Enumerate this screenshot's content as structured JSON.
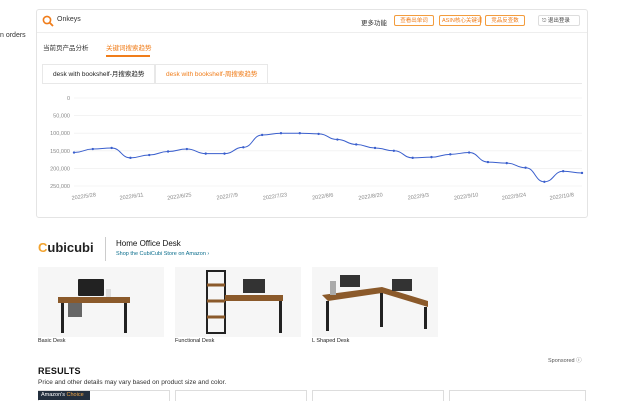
{
  "page": {
    "left_cut_text": "n orders"
  },
  "toolbar": {
    "brand": "Onkeys",
    "more_label": "更多功能",
    "buttons": [
      "查看出单词",
      "ASIN核心关键词",
      "竞品反查数",
      "竞品报告"
    ],
    "logout": "退出登录"
  },
  "main_tabs": [
    {
      "label": "当前页产品分析",
      "active": false
    },
    {
      "label": "关键词搜索趋势",
      "active": true
    }
  ],
  "keyword_tabs": [
    {
      "label": "desk with bookshelf-月搜索趋势",
      "active": false
    },
    {
      "label": "desk with bookshelf-周搜索趋势",
      "active": true
    }
  ],
  "chart_data": {
    "type": "line",
    "y_ticks": [
      "0",
      "50,000",
      "100,000",
      "150,000",
      "200,000",
      "250,000"
    ],
    "x_ticks": [
      "2022/5/28",
      "2022/6/11",
      "2022/6/25",
      "2022/7/9",
      "2022/7/23",
      "2022/8/6",
      "2022/8/20",
      "2022/9/3",
      "2022/9/10",
      "2022/9/24",
      "2022/10/8"
    ],
    "ylim": [
      0,
      250000
    ],
    "y_inverted": true,
    "grid": true,
    "series_color": "#3a5fcd",
    "values": [
      155000,
      145000,
      142000,
      170000,
      162000,
      152000,
      145000,
      158000,
      158000,
      140000,
      105000,
      100000,
      100000,
      102000,
      118000,
      132000,
      142000,
      150000,
      170000,
      168000,
      160000,
      155000,
      182000,
      185000,
      198000,
      238000,
      208000,
      213000
    ]
  },
  "brand_store": {
    "logo_part1": "C",
    "logo_part2": "ubicubi",
    "title": "Home Office Desk",
    "link": "Shop the CubiCubi Store on Amazon ›"
  },
  "products": [
    {
      "label": "Basic Desk"
    },
    {
      "label": "Functional Desk"
    },
    {
      "label": "L Shaped Desk"
    }
  ],
  "sponsored": "Sponsored ⓘ",
  "results": {
    "heading": "RESULTS",
    "note": "Price and other details may vary based on product size and color."
  },
  "badge": {
    "part1": "Amazon's",
    "part2": "Choice"
  }
}
